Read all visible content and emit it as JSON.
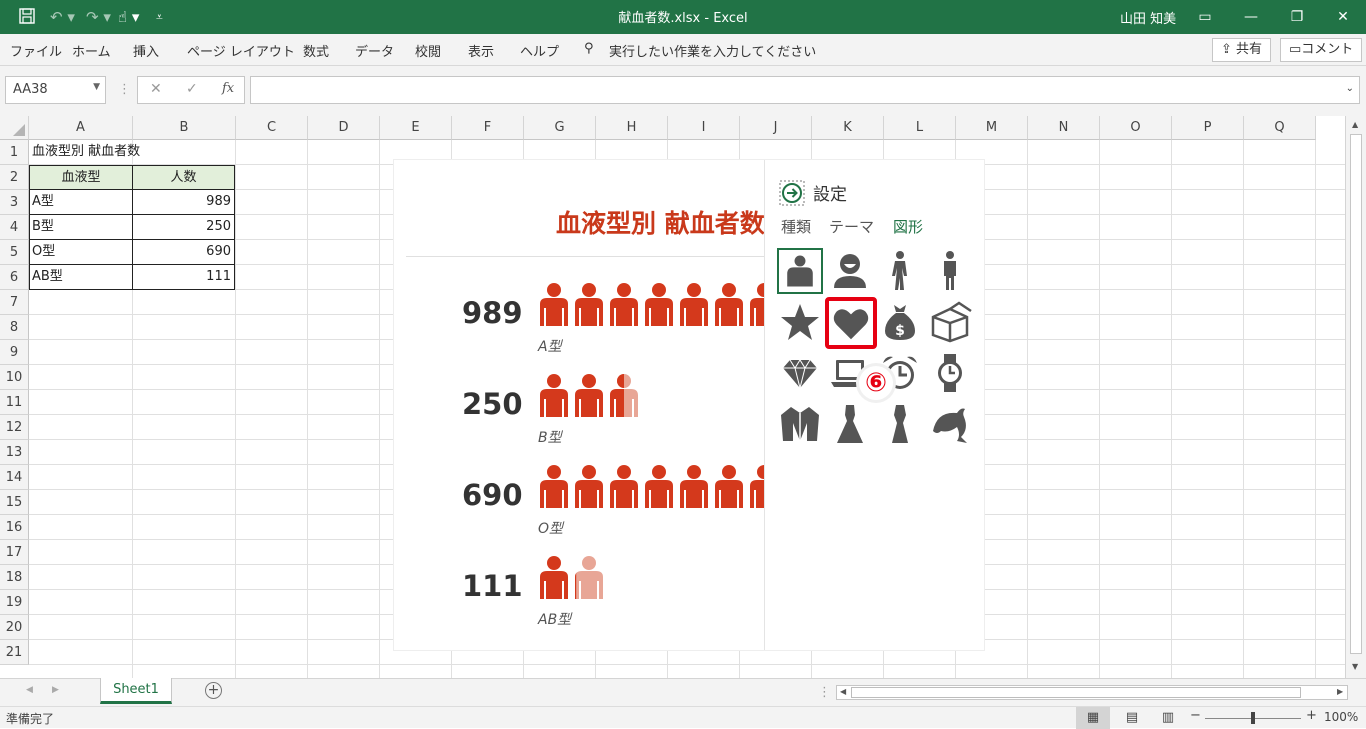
{
  "window": {
    "title": "献血者数.xlsx  -  Excel",
    "user": "山田 知美"
  },
  "menu": {
    "items": [
      "ファイル",
      "ホーム",
      "挿入",
      "ページ レイアウト",
      "数式",
      "データ",
      "校閲",
      "表示",
      "ヘルプ"
    ],
    "search_placeholder": "実行したい作業を入力してください",
    "share_label": "共有",
    "comment_label": "コメント"
  },
  "formula_bar": {
    "name_box": "AA38",
    "fx_label": "fx",
    "formula": ""
  },
  "grid": {
    "columns": [
      "A",
      "B",
      "C",
      "D",
      "E",
      "F",
      "G",
      "H",
      "I",
      "J",
      "K",
      "L",
      "M",
      "N",
      "O",
      "P",
      "Q"
    ],
    "rows": [
      "1",
      "2",
      "3",
      "4",
      "5",
      "6",
      "7",
      "8",
      "9",
      "10",
      "11",
      "12",
      "13",
      "14",
      "15",
      "16",
      "17",
      "18",
      "19",
      "20",
      "21"
    ]
  },
  "sheet": {
    "title": "血液型別 献血者数",
    "header_type": "血液型",
    "header_count": "人数",
    "table": [
      {
        "type": "A型",
        "count": "989"
      },
      {
        "type": "B型",
        "count": "250"
      },
      {
        "type": "O型",
        "count": "690"
      },
      {
        "type": "AB型",
        "count": "111"
      }
    ]
  },
  "chart": {
    "title": "血液型別 献血者数",
    "rows": [
      {
        "value": "989",
        "label": "A型",
        "icons": 7
      },
      {
        "value": "250",
        "label": "B型",
        "icons": 2.5
      },
      {
        "value": "690",
        "label": "O型",
        "icons": 7
      },
      {
        "value": "111",
        "label": "AB型",
        "icons": 1.1
      }
    ],
    "icon_color": "#d4391c",
    "icon_faded": "#e8a696"
  },
  "chart_data": {
    "type": "bar",
    "title": "血液型別 献血者数",
    "categories": [
      "A型",
      "B型",
      "O型",
      "AB型"
    ],
    "values": [
      989,
      250,
      690,
      111
    ]
  },
  "pane": {
    "title": "設定",
    "tabs": [
      "種類",
      "テーマ",
      "図形"
    ],
    "active_tab": "図形",
    "icons": [
      "person-shirt-icon",
      "person-bust-icon",
      "man-walking-icon",
      "man-standing-icon",
      "star-icon",
      "heart-icon",
      "money-bag-icon",
      "box-icon",
      "diamond-icon",
      "laptop-icon",
      "alarm-clock-icon",
      "watch-icon",
      "jacket-icon",
      "dress-icon",
      "gown-icon",
      "dolphin-icon"
    ],
    "step_marker": "⑥"
  },
  "sheet_tabs": {
    "active": "Sheet1"
  },
  "status": {
    "ready": "準備完了",
    "zoom": "100%"
  }
}
